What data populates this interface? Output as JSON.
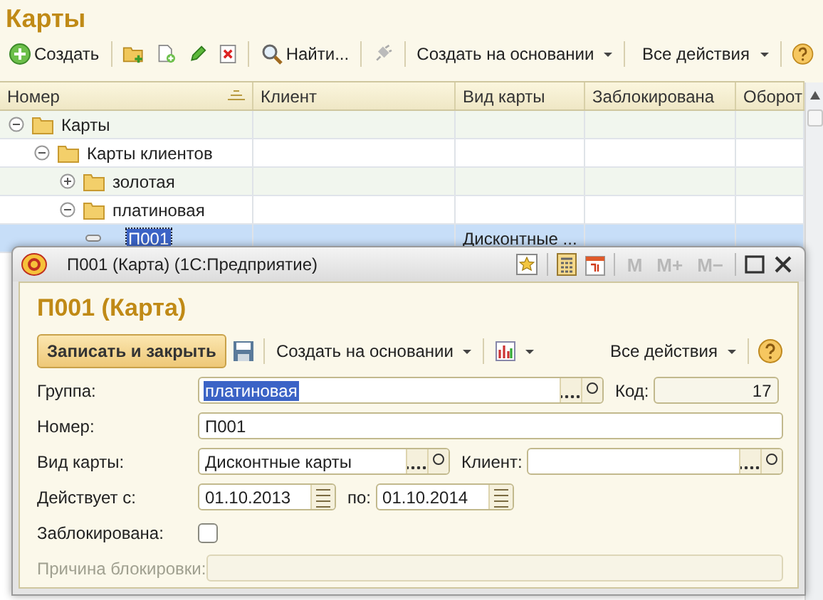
{
  "page": {
    "title": "Карты"
  },
  "toolbar": {
    "create": "Создать",
    "find": "Найти...",
    "create_based": "Создать на основании",
    "all_actions": "Все действия"
  },
  "table": {
    "columns": [
      {
        "label": "Номер",
        "sorted": true
      },
      {
        "label": "Клиент",
        "sorted": false
      },
      {
        "label": "Вид карты",
        "sorted": false
      },
      {
        "label": "Заблокирована",
        "sorted": false
      },
      {
        "label": "Оборот",
        "sorted": false
      }
    ],
    "rows": [
      {
        "kind": "folder",
        "name": "Карты",
        "expanded": true,
        "selected": false,
        "children": [
          {
            "kind": "folder",
            "name": "Карты клиентов",
            "expanded": true,
            "selected": false,
            "children": [
              {
                "kind": "folder",
                "name": "золотая",
                "expanded": false,
                "selected": false
              },
              {
                "kind": "folder",
                "name": "платиновая",
                "expanded": true,
                "selected": false,
                "children": [
                  {
                    "kind": "item",
                    "name": "П001",
                    "card_type": "Дисконтные ...",
                    "selected": true
                  }
                ]
              }
            ]
          }
        ]
      }
    ]
  },
  "dialog": {
    "title": "П001 (Карта)  (1С:Предприятие)",
    "memory_buttons": [
      "M",
      "M+",
      "M−"
    ],
    "heading": "П001 (Карта)",
    "toolbar": {
      "save_close": "Записать и закрыть",
      "create_based": "Создать на основании",
      "all_actions": "Все действия"
    },
    "fields": {
      "group": {
        "label": "Группа:",
        "value": "платиновая",
        "text_selected": true
      },
      "code": {
        "label": "Код:",
        "value": "17"
      },
      "number": {
        "label": "Номер:",
        "value": "П001"
      },
      "card_type": {
        "label": "Вид карты:",
        "value": "Дисконтные карты"
      },
      "client": {
        "label": "Клиент:"
      },
      "valid_from": {
        "label": "Действует с:",
        "value": "01.10.2013"
      },
      "valid_to": {
        "label": "по:",
        "value": "01.10.2014"
      },
      "blocked": {
        "label": "Заблокирована:",
        "checked": false
      },
      "block_reason": {
        "label": "Причина блокировки:",
        "disabled": true
      }
    }
  }
}
